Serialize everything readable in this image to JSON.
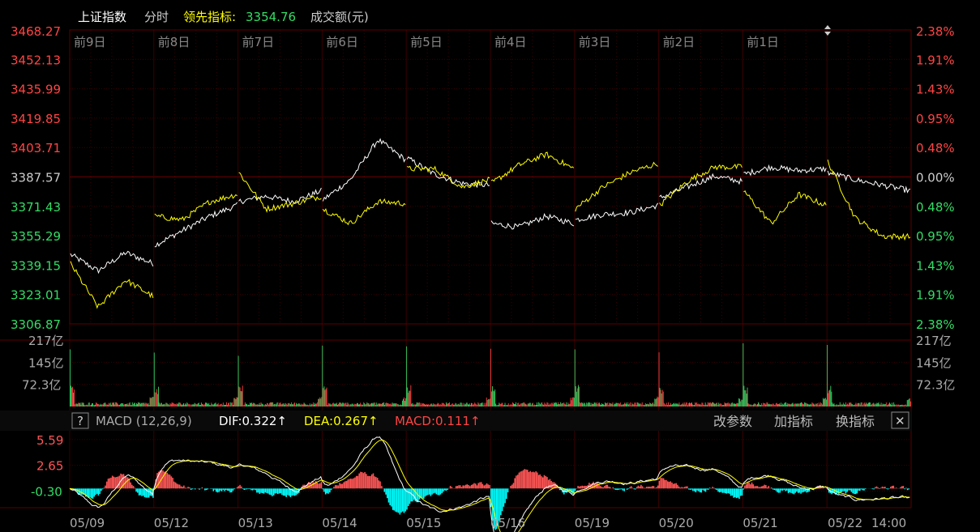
{
  "header": {
    "title": "上证指数",
    "mode": "分时",
    "lead_label": "领先指标:",
    "lead_value": "3354.76",
    "vol_label": "成交额(元)"
  },
  "macd_bar": {
    "help": "?",
    "name": "MACD (12,26,9)",
    "dif": "DIF:0.322↑",
    "dea": "DEA:0.267↑",
    "macd": "MACD:0.111↑",
    "btn_params": "改参数",
    "btn_add": "加指标",
    "btn_switch": "换指标",
    "btn_close": "✕"
  },
  "colors": {
    "up": "#ff4444",
    "down": "#33dd66",
    "price_line": "#ffffff",
    "lead_line": "#ffff00",
    "macd_neg": "#00ffff",
    "macd_pos": "#ff5555",
    "grid": "#3a0000"
  },
  "chart_data": {
    "type": "line",
    "day_labels": [
      "前9日",
      "前8日",
      "前7日",
      "前6日",
      "前5日",
      "前4日",
      "前3日",
      "前2日",
      "前1日"
    ],
    "price_ticks_up": [
      "3468.27",
      "3452.13",
      "3435.99",
      "3419.85",
      "3403.71"
    ],
    "price_tick_mid": "3387.57",
    "price_ticks_down": [
      "3371.43",
      "3355.29",
      "3339.15",
      "3323.01",
      "3306.87"
    ],
    "pct_ticks_up": [
      "2.38%",
      "1.91%",
      "1.43%",
      "0.95%",
      "0.48%"
    ],
    "pct_tick_mid": "0.00%",
    "pct_ticks_down": [
      "0.48%",
      "0.95%",
      "1.43%",
      "1.91%",
      "2.38%"
    ],
    "ylim": [
      3306.87,
      3468.27
    ],
    "base_price": 3387.57,
    "volume_ticks": [
      "217亿",
      "145亿",
      "72.3亿"
    ],
    "volume_max": 217,
    "macd_ticks": [
      "5.59",
      "2.65",
      "-0.30"
    ],
    "macd_ylim": [
      -2.2,
      6.6
    ],
    "x_labels": [
      "05/09",
      "05/12",
      "05/13",
      "05/14",
      "05/15",
      "05/16",
      "05/19",
      "05/20",
      "05/21",
      "05/22",
      "14:00"
    ],
    "series": [
      {
        "name": "上证指数",
        "color": "#ffffff",
        "day_anchors": [
          [
            3345,
            3336,
            3346,
            3340
          ],
          [
            3350,
            3358,
            3366,
            3372
          ],
          [
            3374,
            3377,
            3374,
            3380
          ],
          [
            3375,
            3386,
            3408,
            3397
          ],
          [
            3398,
            3389,
            3384,
            3383
          ],
          [
            3362,
            3360,
            3366,
            3362
          ],
          [
            3364,
            3367,
            3368,
            3372
          ],
          [
            3376,
            3382,
            3388,
            3385
          ],
          [
            3389,
            3393,
            3391,
            3392
          ],
          [
            3390,
            3386,
            3383,
            3380
          ]
        ]
      },
      {
        "name": "领先指标",
        "color": "#ffff00",
        "day_anchors": [
          [
            3340,
            3316,
            3331,
            3322
          ],
          [
            3366,
            3364,
            3374,
            3378
          ],
          [
            3390,
            3370,
            3373,
            3377
          ],
          [
            3370,
            3362,
            3374,
            3373
          ],
          [
            3392,
            3392,
            3382,
            3386
          ],
          [
            3384,
            3394,
            3400,
            3392
          ],
          [
            3370,
            3382,
            3390,
            3395
          ],
          [
            3372,
            3385,
            3393,
            3393
          ],
          [
            3380,
            3362,
            3378,
            3372
          ],
          [
            3396,
            3365,
            3355,
            3354.76
          ]
        ]
      }
    ],
    "grid": true
  }
}
